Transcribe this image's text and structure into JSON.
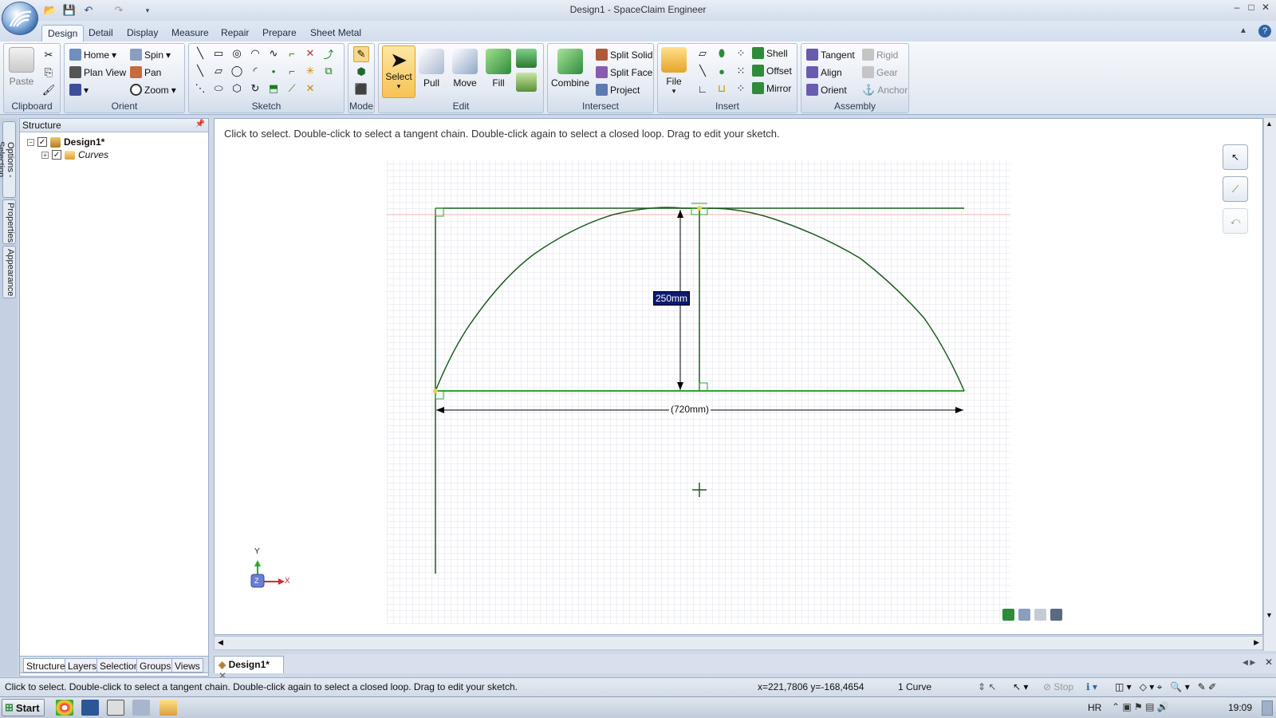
{
  "window": {
    "title": "Design1 - SpaceClaim Engineer",
    "minimize": "–",
    "maximize": "□",
    "close": "✕"
  },
  "menu_tabs": [
    "Design",
    "Detail",
    "Display",
    "Measure",
    "Repair",
    "Prepare",
    "Sheet Metal"
  ],
  "ribbon": {
    "clipboard": {
      "label": "Clipboard",
      "paste": "Paste"
    },
    "orient": {
      "label": "Orient",
      "home": "Home",
      "plan_view": "Plan View",
      "spin": "Spin",
      "pan": "Pan",
      "zoom": "Zoom"
    },
    "sketch": {
      "label": "Sketch"
    },
    "mode": {
      "label": "Mode"
    },
    "edit": {
      "label": "Edit",
      "select": "Select",
      "pull": "Pull",
      "move": "Move",
      "fill": "Fill"
    },
    "intersect": {
      "label": "Intersect",
      "combine": "Combine",
      "split_solid": "Split Solid",
      "split_face": "Split Face",
      "project": "Project"
    },
    "insert": {
      "label": "Insert",
      "file": "File",
      "shell": "Shell",
      "offset": "Offset",
      "mirror": "Mirror"
    },
    "assembly": {
      "label": "Assembly",
      "tangent": "Tangent",
      "align": "Align",
      "orient": "Orient",
      "rigid": "Rigid",
      "gear": "Gear",
      "anchor": "Anchor"
    }
  },
  "side_tabs": [
    "Options - Selection",
    "Properties",
    "Appearance"
  ],
  "structure": {
    "title": "Structure",
    "tree": [
      {
        "label": "Design1*",
        "expanded": true,
        "checked": true
      },
      {
        "label": "Curves",
        "expanded": false,
        "checked": true
      }
    ],
    "bottom_tabs": [
      "Structure",
      "Layers",
      "Selection",
      "Groups",
      "Views"
    ]
  },
  "canvas": {
    "hint": "Click to select. Double-click to select a tangent chain. Double-click again to select a closed loop. Drag to edit your sketch.",
    "dim_height": "250mm",
    "dim_width": "(720mm)",
    "axis_y": "Y",
    "axis_x": "X",
    "axis_z": "Z"
  },
  "doc_tab": {
    "label": "Design1*"
  },
  "status": {
    "message": "Click to select. Double-click to select a tangent chain. Double-click again to select a closed loop. Drag to edit your sketch.",
    "coords": "x=221,7806  y=-168,4654",
    "selection": "1 Curve",
    "stop": "Stop"
  },
  "taskbar": {
    "start": "Start",
    "lang": "HR",
    "time": "19:09"
  },
  "colors": {
    "sketch_line": "#1e5a1e",
    "grid": "#cfd5e6",
    "accent": "#2f63a6"
  }
}
